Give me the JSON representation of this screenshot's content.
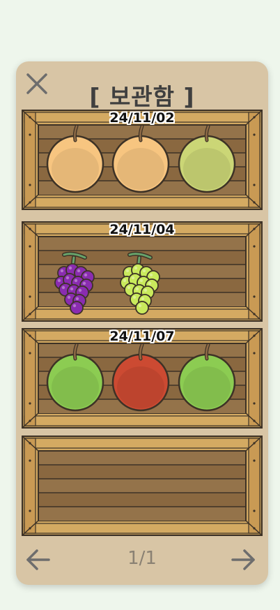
{
  "header": {
    "title": "[ 보관함 ]"
  },
  "crates": [
    {
      "date": "24/11/02",
      "fruits": [
        "yellow-pear",
        "yellow-pear",
        "green-pear"
      ]
    },
    {
      "date": "24/11/04",
      "fruits": [
        "purple-grapes",
        "green-grapes"
      ]
    },
    {
      "date": "24/11/07",
      "fruits": [
        "green-apple",
        "red-apple",
        "green-apple"
      ]
    },
    {
      "date": "",
      "fruits": []
    }
  ],
  "pagination": {
    "label": "1/1",
    "prev_icon": "arrow-left-icon",
    "next_icon": "arrow-right-icon"
  },
  "colors": {
    "background": "#eef6ec",
    "panel": "#d8c5a5",
    "wood_light": "#d4aa62",
    "wood_dark": "#866640",
    "outline": "#3d3226",
    "yellow_pear": "#f7c580",
    "green_pear": "#cbd676",
    "green_apple": "#8ccc52",
    "red_apple": "#cc4a32",
    "purple_grape": "#8a2cb0",
    "green_grape": "#c9ea5c"
  }
}
